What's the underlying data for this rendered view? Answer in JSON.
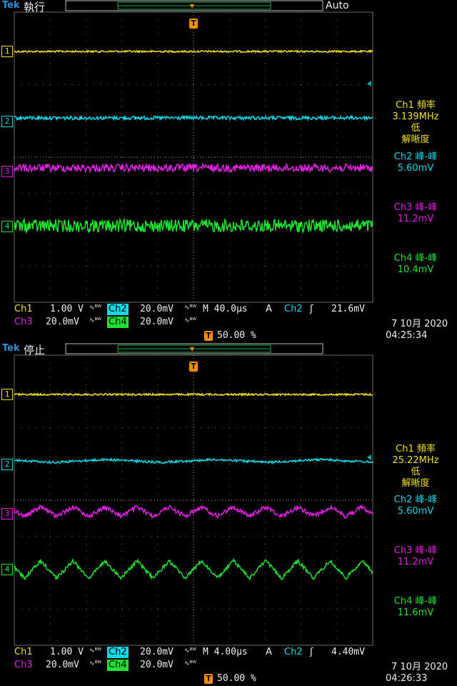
{
  "colors": {
    "ch1": "#f0e020",
    "ch2": "#10d8e8",
    "ch3": "#e020e0",
    "ch4": "#20e030",
    "trigger": "#ff8c00",
    "grid": "#6a6a6a"
  },
  "scopes": [
    {
      "brand": "Tek",
      "state": "執行",
      "mode": "Auto",
      "markers": {
        "ch1": "1",
        "ch2": "2",
        "ch3": "3",
        "ch4": "4",
        "trigger": "T"
      },
      "measurements": {
        "ch1_label": "Ch1 頻率",
        "ch1_value": "3.139MHz",
        "ch1_note1": "低",
        "ch1_note2": "解晰度",
        "ch2_label": "Ch2 峰-峰",
        "ch2_value": "5.60mV",
        "ch3_label": "Ch3 峰-峰",
        "ch3_value": "11.2mV",
        "ch4_label": "Ch4 峰-峰",
        "ch4_value": "10.4mV"
      },
      "status": {
        "ch1_tag": "Ch1",
        "ch1_scale": "1.00 V",
        "ch2_tag": "Ch2",
        "ch2_scale": "20.0mV",
        "ch3_tag": "Ch3",
        "ch3_scale": "20.0mV",
        "ch4_tag": "Ch4",
        "ch4_scale": "20.0mV",
        "bw_symbol": "∿ᴮᵂ",
        "timebase": "M 40.0µs",
        "acq": "A",
        "trig_src": "Ch2",
        "trig_slope": "ʃ",
        "trig_level": "21.6mV",
        "trig_pos": "50.00 %",
        "date": "7 10月 2020",
        "time": "04:25:34"
      }
    },
    {
      "brand": "Tek",
      "state": "停止",
      "mode": "",
      "markers": {
        "ch1": "1",
        "ch2": "2",
        "ch3": "3",
        "ch4": "4",
        "trigger": "T"
      },
      "measurements": {
        "ch1_label": "Ch1 頻率",
        "ch1_value": "25.22MHz",
        "ch1_note1": "低",
        "ch1_note2": "解晰度",
        "ch2_label": "Ch2 峰-峰",
        "ch2_value": "5.60mV",
        "ch3_label": "Ch3 峰-峰",
        "ch3_value": "11.2mV",
        "ch4_label": "Ch4 峰-峰",
        "ch4_value": "11.6mV"
      },
      "status": {
        "ch1_tag": "Ch1",
        "ch1_scale": "1.00 V",
        "ch2_tag": "Ch2",
        "ch2_scale": "20.0mV",
        "ch3_tag": "Ch3",
        "ch3_scale": "20.0mV",
        "ch4_tag": "Ch4",
        "ch4_scale": "20.0mV",
        "bw_symbol": "∿ᴮᵂ",
        "timebase": "M 4.00µs",
        "acq": "A",
        "trig_src": "Ch2",
        "trig_slope": "ʃ",
        "trig_level": "4.40mV",
        "trig_pos": "50.00 %",
        "date": "7 10月 2020",
        "time": "04:26:33"
      }
    }
  ]
}
